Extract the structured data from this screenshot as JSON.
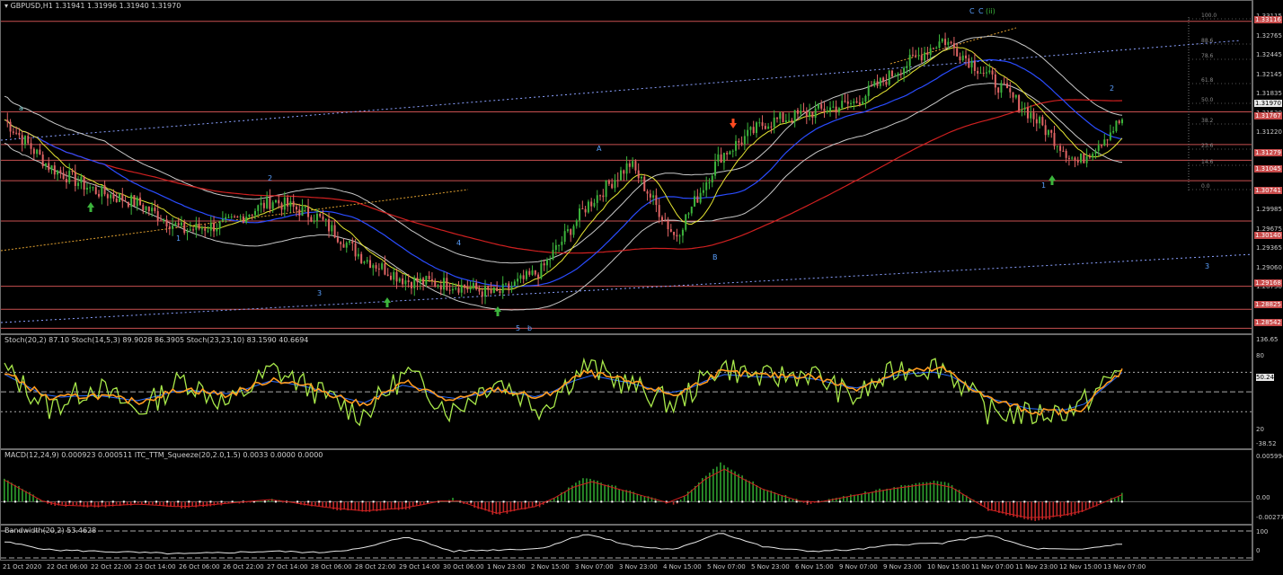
{
  "colors": {
    "background": "#000000",
    "bull_candle": "#3cb43c",
    "bear_candle": "#e06464",
    "level_line": "#c85050",
    "ma_blue": "#2a4cff",
    "ma_red": "#d02020",
    "ma_yellow": "#e6e632",
    "bollinger": "#c8c8c8",
    "fib_dotted": "#8aa0ff",
    "stoch_green": "#a8e84a",
    "stoch_orange": "#ff9a1e",
    "macd_green": "#2ea02e",
    "macd_red": "#c02828"
  },
  "main": {
    "header": "GBPUSD,H1  1.31941 1.31996 1.31940 1.31970",
    "price_ticks": [
      "1.33115",
      "1.32765",
      "1.32445",
      "1.32145",
      "1.31835",
      "1.31530",
      "1.31220",
      "1.30910",
      "1.30600",
      "1.30295",
      "1.29985",
      "1.29675",
      "1.29365",
      "1.29060",
      "1.28750",
      "1.28440"
    ],
    "price_tags": [
      {
        "text": "1.33116",
        "style": "red"
      },
      {
        "text": "1.31970",
        "style": "cur"
      },
      {
        "text": "1.31767",
        "style": "red"
      },
      {
        "text": "1.31279",
        "style": "red"
      },
      {
        "text": "1.31045",
        "style": "red"
      },
      {
        "text": "1.30741",
        "style": "red"
      },
      {
        "text": "1.30140",
        "style": "red"
      },
      {
        "text": "1.29168",
        "style": "red"
      },
      {
        "text": "1.28825",
        "style": "red"
      },
      {
        "text": "1.28542",
        "style": "red"
      }
    ],
    "fib_labels": [
      "100.0",
      "88.6",
      "78.6",
      "61.8",
      "50.0",
      "38.2",
      "23.6",
      "14.6",
      "0.0"
    ],
    "wave_labels": [
      "a",
      "1",
      "2",
      "3",
      "4",
      "5",
      "b",
      "A",
      "B",
      "1",
      "2",
      "3",
      "C",
      "C",
      "(ii)"
    ]
  },
  "stoch": {
    "header": "Stoch(20,2) 87.10  Stoch(14,5,3) 89.9028 86.3905  Stoch(23,23,10) 83.1590 40.6694",
    "ticks": [
      "136.65",
      "80",
      "50.24",
      "20",
      "-38.52"
    ]
  },
  "macd": {
    "header": "MACD(12,24,9) 0.000923 0.000511  ITC_TTM_Squeeze(20,2.0,1.5) 0.0033 0.0000 0.0000",
    "ticks": [
      "0.005994",
      "0.00",
      "-0.002778"
    ]
  },
  "bandwidth": {
    "header": "Bandwidth(20,2) 53.4628",
    "ticks": [
      "100",
      "0"
    ]
  },
  "time_labels": [
    "21 Oct 2020",
    "22 Oct 06:00",
    "22 Oct 22:00",
    "23 Oct 14:00",
    "26 Oct 06:00",
    "26 Oct 22:00",
    "27 Oct 14:00",
    "28 Oct 06:00",
    "28 Oct 22:00",
    "29 Oct 14:00",
    "30 Oct 06:00",
    "1 Nov 23:00",
    "2 Nov 15:00",
    "3 Nov 07:00",
    "3 Nov 23:00",
    "4 Nov 15:00",
    "5 Nov 07:00",
    "5 Nov 23:00",
    "6 Nov 15:00",
    "9 Nov 07:00",
    "9 Nov 23:00",
    "10 Nov 15:00",
    "11 Nov 07:00",
    "11 Nov 23:00",
    "12 Nov 15:00",
    "13 Nov 07:00"
  ],
  "chart_data": [
    {
      "type": "line",
      "title": "GBPUSD,H1",
      "description_values": {
        "open": 1.31941,
        "high": 1.31996,
        "low": 1.3194,
        "close": 1.3197
      },
      "ylim": [
        1.2844,
        1.3342
      ],
      "x": [
        "21 Oct 2020",
        "22 Oct 06:00",
        "22 Oct 22:00",
        "23 Oct 14:00",
        "26 Oct 06:00",
        "26 Oct 22:00",
        "27 Oct 14:00",
        "28 Oct 06:00",
        "28 Oct 22:00",
        "29 Oct 14:00",
        "30 Oct 06:00",
        "1 Nov 23:00",
        "2 Nov 15:00",
        "3 Nov 07:00",
        "3 Nov 23:00",
        "4 Nov 15:00",
        "5 Nov 07:00",
        "5 Nov 23:00",
        "6 Nov 15:00",
        "9 Nov 07:00",
        "9 Nov 23:00",
        "10 Nov 15:00",
        "11 Nov 07:00",
        "11 Nov 23:00",
        "12 Nov 15:00",
        "13 Nov 07:00"
      ],
      "series": [
        {
          "values": [
            1.3165,
            1.3095,
            1.306,
            1.304,
            1.3,
            1.301,
            1.3045,
            1.302,
            1.296,
            1.2925,
            1.292,
            1.2905,
            1.294,
            1.3035,
            1.31,
            1.299,
            1.311,
            1.316,
            1.3175,
            1.319,
            1.324,
            1.3285,
            1.323,
            1.317,
            1.31,
            1.3165
          ]
        }
      ],
      "levels": [
        1.33116,
        1.31767,
        1.31279,
        1.31045,
        1.30741,
        1.3014,
        1.29168,
        1.28825,
        1.28542
      ]
    },
    {
      "type": "line",
      "title": "Stoch(20,2)",
      "ylim": [
        -38.52,
        136.65
      ],
      "x": [
        "21 Oct 2020",
        "22 Oct 06:00",
        "22 Oct 22:00",
        "23 Oct 14:00",
        "26 Oct 06:00",
        "26 Oct 22:00",
        "27 Oct 14:00",
        "28 Oct 06:00",
        "28 Oct 22:00",
        "29 Oct 14:00",
        "30 Oct 06:00",
        "1 Nov 23:00",
        "2 Nov 15:00",
        "3 Nov 07:00",
        "3 Nov 23:00",
        "4 Nov 15:00",
        "5 Nov 07:00",
        "5 Nov 23:00",
        "6 Nov 15:00",
        "9 Nov 07:00",
        "9 Nov 23:00",
        "10 Nov 15:00",
        "11 Nov 07:00",
        "11 Nov 23:00",
        "12 Nov 15:00",
        "13 Nov 07:00"
      ],
      "series": [
        {
          "values": [
            85,
            25,
            60,
            20,
            70,
            30,
            85,
            50,
            15,
            80,
            20,
            70,
            25,
            90,
            60,
            30,
            90,
            70,
            80,
            40,
            85,
            90,
            20,
            15,
            25,
            87
          ]
        },
        {
          "values": [
            80,
            40,
            45,
            35,
            55,
            45,
            70,
            55,
            30,
            65,
            35,
            55,
            40,
            80,
            65,
            45,
            80,
            75,
            75,
            55,
            80,
            85,
            40,
            20,
            20,
            83
          ]
        }
      ],
      "reference_lines": [
        80,
        50.24,
        20
      ]
    },
    {
      "type": "bar",
      "title": "MACD(12,24,9)",
      "ylim": [
        -0.002778,
        0.005994
      ],
      "x": [
        "21 Oct 2020",
        "22 Oct 06:00",
        "22 Oct 22:00",
        "23 Oct 14:00",
        "26 Oct 06:00",
        "26 Oct 22:00",
        "27 Oct 14:00",
        "28 Oct 06:00",
        "28 Oct 22:00",
        "29 Oct 14:00",
        "30 Oct 06:00",
        "1 Nov 23:00",
        "2 Nov 15:00",
        "3 Nov 07:00",
        "3 Nov 23:00",
        "4 Nov 15:00",
        "5 Nov 07:00",
        "5 Nov 23:00",
        "6 Nov 15:00",
        "9 Nov 07:00",
        "9 Nov 23:00",
        "10 Nov 15:00",
        "11 Nov 07:00",
        "11 Nov 23:00",
        "12 Nov 15:00",
        "13 Nov 07:00"
      ],
      "series": [
        {
          "values": [
            0.0028,
            -0.0004,
            -0.0006,
            -0.0003,
            -0.0007,
            -0.0002,
            0.0003,
            -0.0006,
            -0.0012,
            -0.0008,
            0.0004,
            -0.0015,
            -0.0005,
            0.0028,
            0.0012,
            -0.0004,
            0.0045,
            0.0015,
            -0.0003,
            0.0008,
            0.0018,
            0.0025,
            -0.001,
            -0.0022,
            -0.0015,
            0.0009
          ]
        }
      ]
    },
    {
      "type": "line",
      "title": "Bandwidth(20,2)",
      "ylim": [
        0,
        100
      ],
      "x": [
        "21 Oct 2020",
        "22 Oct 06:00",
        "22 Oct 22:00",
        "23 Oct 14:00",
        "26 Oct 06:00",
        "26 Oct 22:00",
        "27 Oct 14:00",
        "28 Oct 06:00",
        "28 Oct 22:00",
        "29 Oct 14:00",
        "30 Oct 06:00",
        "1 Nov 23:00",
        "2 Nov 15:00",
        "3 Nov 07:00",
        "3 Nov 23:00",
        "4 Nov 15:00",
        "5 Nov 07:00",
        "5 Nov 23:00",
        "6 Nov 15:00",
        "9 Nov 07:00",
        "9 Nov 23:00",
        "10 Nov 15:00",
        "11 Nov 07:00",
        "11 Nov 23:00",
        "12 Nov 15:00",
        "13 Nov 07:00"
      ],
      "series": [
        {
          "values": [
            60,
            30,
            25,
            20,
            15,
            20,
            25,
            20,
            35,
            80,
            25,
            30,
            35,
            90,
            45,
            30,
            95,
            40,
            25,
            30,
            50,
            55,
            85,
            35,
            30,
            53
          ]
        }
      ]
    }
  ]
}
